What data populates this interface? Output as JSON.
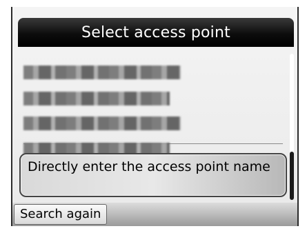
{
  "title": "Select access point",
  "access_points": [
    {
      "name": "",
      "pattern": "pixelated"
    },
    {
      "name": "",
      "pattern": "pixelated"
    },
    {
      "name": "",
      "pattern": "pixelated"
    },
    {
      "name": "",
      "pattern": "pixelated"
    }
  ],
  "direct_entry_label": "Directly enter the access point name",
  "footer": {
    "search_again_label": "Search again"
  },
  "colors": {
    "title_bar": "#000000",
    "title_text": "#ffffff",
    "screen_bg": "#eeeeee",
    "scroll_thumb": "#1a1a1a"
  },
  "icons": [
    "scrollbar-thumb"
  ]
}
